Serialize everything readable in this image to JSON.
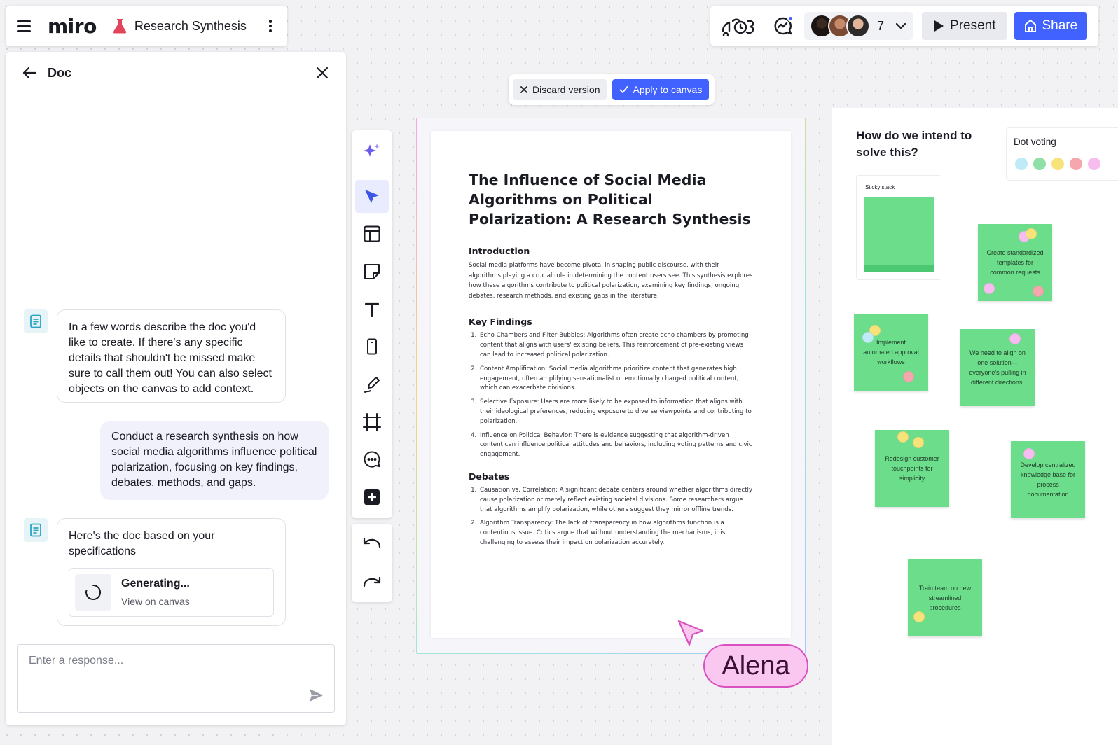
{
  "app": {
    "logo": "miro",
    "board_title": "Research Synthesis"
  },
  "topbar": {
    "collaborator_count": "7",
    "present_label": "Present",
    "share_label": "Share"
  },
  "doc_panel": {
    "title": "Doc",
    "messages": {
      "ai_prompt": "In a few words describe the doc you'd like to create. If there's any specific details that shouldn't be missed make sure to call them out! You can also select objects on the canvas to add context.",
      "user_request": "Conduct a research synthesis on how social media algorithms influence political polarization, focusing on key findings, debates, methods, and gaps.",
      "ai_reply": "Here's the doc based on your specifications",
      "generating_title": "Generating...",
      "generating_link": "View on canvas"
    },
    "response_placeholder": "Enter a response..."
  },
  "version_bar": {
    "discard_label": "Discard version",
    "apply_label": "Apply to canvas"
  },
  "document": {
    "title": "The Influence of Social Media Algorithms on Political Polarization: A Research Synthesis",
    "intro_heading": "Introduction",
    "intro_text": "Social media platforms have become pivotal in shaping public discourse, with their algorithms playing a crucial role in determining the content users see. This synthesis explores how these algorithms contribute to political polarization, examining key findings, ongoing debates, research methods, and existing gaps in the literature.",
    "findings_heading": "Key Findings",
    "findings": [
      "Echo Chambers and Filter Bubbles: Algorithms often create echo chambers by promoting content that aligns with users' existing beliefs. This reinforcement of pre-existing views can lead to increased political polarization.",
      "Content Amplification: Social media algorithms prioritize content that generates high engagement, often amplifying sensationalist or emotionally charged political content, which can exacerbate divisions.",
      "Selective Exposure: Users are more likely to be exposed to information that aligns with their ideological preferences, reducing exposure to diverse viewpoints and contributing to polarization.",
      "Influence on Political Behavior: There is evidence suggesting that algorithm-driven content can influence political attitudes and behaviors, including voting patterns and civic engagement."
    ],
    "debates_heading": "Debates",
    "debates": [
      "Causation vs. Correlation: A significant debate centers around whether algorithms directly cause polarization or merely reflect existing societal divisions. Some researchers argue that algorithms amplify polarization, while others suggest they mirror offline trends.",
      "Algorithm Transparency: The lack of transparency in how algorithms function is a contentious issue. Critics argue that without understanding the mechanisms, it is challenging to assess their impact on polarization accurately."
    ]
  },
  "cursor": {
    "name": "Alena"
  },
  "board": {
    "question": "How do we intend to solve this?",
    "dot_voting_label": "Dot voting",
    "dot_colors": [
      "#bfeaf7",
      "#8fe0a6",
      "#f8e27a",
      "#f6a7ae",
      "#f7bdf0"
    ],
    "sticky_stack_label": "Sticky stack",
    "stickies": [
      "Create standardized templates for common requests",
      "Implement automated approval workflows",
      "We need to align on one solution—everyone's pulling in different directions.",
      "Redesign customer touchpoints for simplicity",
      "Develop centralized knowledge base for process documentation",
      "Train team on new streamlined procedures"
    ]
  },
  "colors": {
    "accent": "#4262ff",
    "sticky_green": "#6bdd8b",
    "cursor_pink": "#f9c7ef"
  }
}
